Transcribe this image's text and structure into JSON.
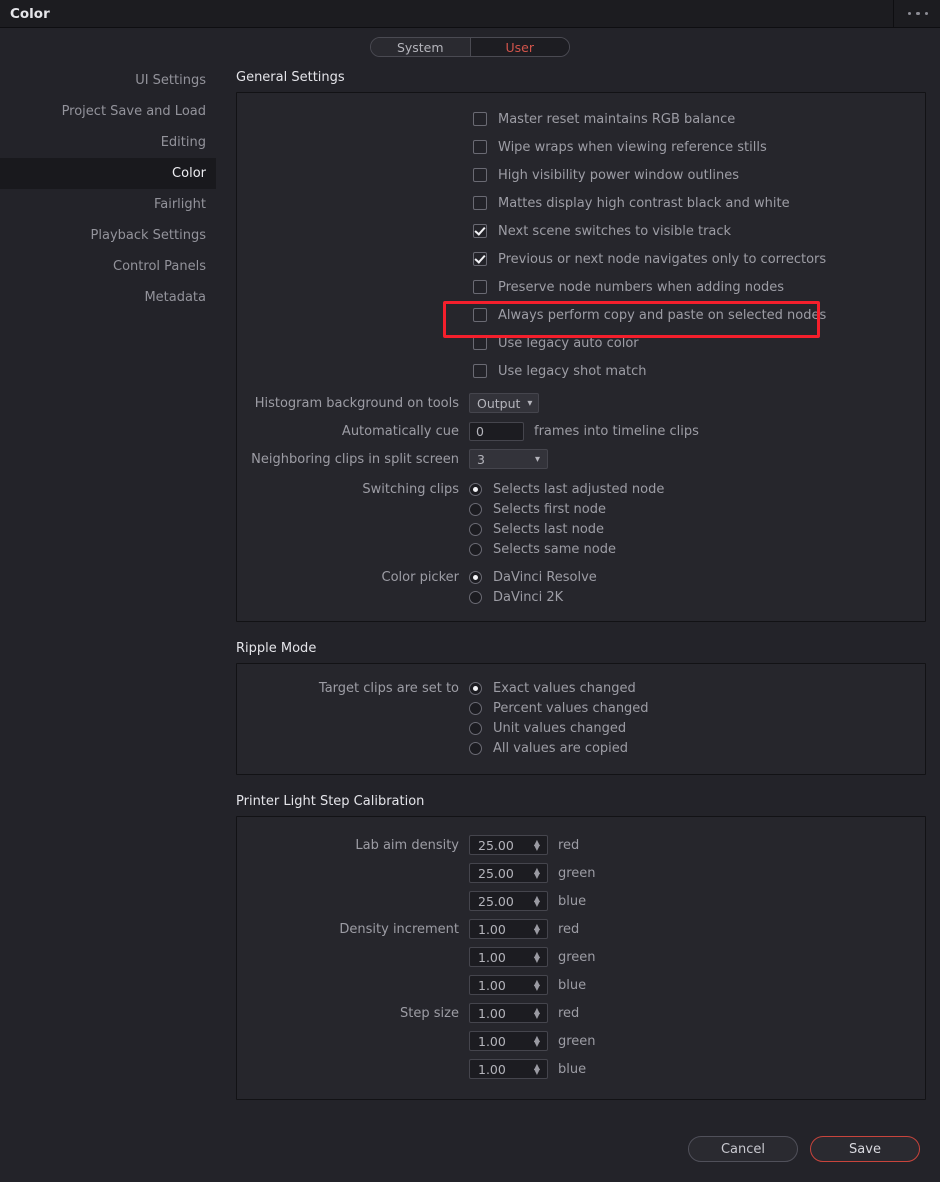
{
  "window": {
    "title": "Color",
    "menu_icon": "ellipsis-icon"
  },
  "tabs": [
    {
      "label": "System",
      "active": false
    },
    {
      "label": "User",
      "active": true
    }
  ],
  "sidebar": {
    "items": [
      {
        "label": "UI Settings",
        "active": false
      },
      {
        "label": "Project Save and Load",
        "active": false
      },
      {
        "label": "Editing",
        "active": false
      },
      {
        "label": "Color",
        "active": true
      },
      {
        "label": "Fairlight",
        "active": false
      },
      {
        "label": "Playback Settings",
        "active": false
      },
      {
        "label": "Control Panels",
        "active": false
      },
      {
        "label": "Metadata",
        "active": false
      }
    ]
  },
  "general_settings": {
    "title": "General Settings",
    "checkboxes": [
      {
        "label": "Master reset maintains RGB balance",
        "checked": false
      },
      {
        "label": "Wipe wraps when viewing reference stills",
        "checked": false
      },
      {
        "label": "High visibility power window outlines",
        "checked": false
      },
      {
        "label": "Mattes display high contrast black and white",
        "checked": false
      },
      {
        "label": "Next scene switches to visible track",
        "checked": true
      },
      {
        "label": "Previous or next node navigates only to correctors",
        "checked": true
      },
      {
        "label": "Preserve node numbers when adding nodes",
        "checked": false
      },
      {
        "label": "Always perform copy and paste on selected nodes",
        "checked": false,
        "highlighted": true
      },
      {
        "label": "Use legacy auto color",
        "checked": false
      },
      {
        "label": "Use legacy shot match",
        "checked": false
      }
    ],
    "histogram": {
      "label": "Histogram background on tools",
      "value": "Output",
      "options": [
        "Output"
      ]
    },
    "auto_cue": {
      "label": "Automatically cue",
      "value": "0",
      "suffix": "frames into timeline clips"
    },
    "neighboring": {
      "label": "Neighboring clips in split screen",
      "value": "3",
      "options": [
        "3"
      ]
    },
    "switching_clips": {
      "label": "Switching clips",
      "options": [
        {
          "label": "Selects last adjusted node",
          "selected": true
        },
        {
          "label": "Selects first node",
          "selected": false
        },
        {
          "label": "Selects last node",
          "selected": false
        },
        {
          "label": "Selects same node",
          "selected": false
        }
      ]
    },
    "color_picker": {
      "label": "Color picker",
      "options": [
        {
          "label": "DaVinci Resolve",
          "selected": true
        },
        {
          "label": "DaVinci 2K",
          "selected": false
        }
      ]
    }
  },
  "ripple_mode": {
    "title": "Ripple Mode",
    "target_clips": {
      "label": "Target clips are set to",
      "options": [
        {
          "label": "Exact values changed",
          "selected": true
        },
        {
          "label": "Percent values changed",
          "selected": false
        },
        {
          "label": "Unit values changed",
          "selected": false
        },
        {
          "label": "All values are copied",
          "selected": false
        }
      ]
    }
  },
  "printer_light": {
    "title": "Printer Light Step Calibration",
    "groups": [
      {
        "label": "Lab aim density",
        "rows": [
          {
            "value": "25.00",
            "channel": "red"
          },
          {
            "value": "25.00",
            "channel": "green"
          },
          {
            "value": "25.00",
            "channel": "blue"
          }
        ]
      },
      {
        "label": "Density increment",
        "rows": [
          {
            "value": "1.00",
            "channel": "red"
          },
          {
            "value": "1.00",
            "channel": "green"
          },
          {
            "value": "1.00",
            "channel": "blue"
          }
        ]
      },
      {
        "label": "Step size",
        "rows": [
          {
            "value": "1.00",
            "channel": "red"
          },
          {
            "value": "1.00",
            "channel": "green"
          },
          {
            "value": "1.00",
            "channel": "blue"
          }
        ]
      }
    ]
  },
  "footer": {
    "cancel_label": "Cancel",
    "save_label": "Save"
  },
  "colors": {
    "accent_red": "#d1544b",
    "highlight_red": "#f41f2c",
    "panel_bg": "#26262c",
    "window_bg": "#232329"
  }
}
